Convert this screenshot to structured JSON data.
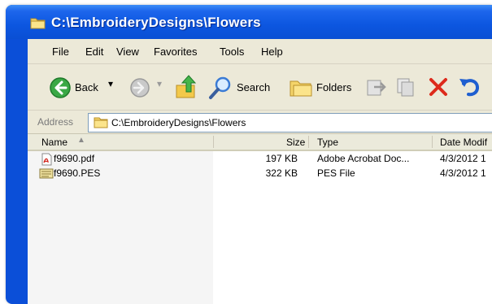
{
  "window": {
    "title": "C:\\EmbroideryDesigns\\Flowers",
    "accent": "#0b4fd8"
  },
  "menu": [
    "File",
    "Edit",
    "View",
    "Favorites",
    "Tools",
    "Help"
  ],
  "toolbar": {
    "back_label": "Back",
    "search_label": "Search",
    "folders_label": "Folders",
    "icons": [
      "back-arrow-icon",
      "forward-arrow-icon",
      "up-folder-icon",
      "search-icon",
      "folders-icon",
      "move-to-icon",
      "copy-to-icon",
      "delete-x-icon",
      "undo-icon"
    ]
  },
  "address": {
    "label": "Address",
    "path": "C:\\EmbroideryDesigns\\Flowers"
  },
  "columns": {
    "name": "Name",
    "size": "Size",
    "type": "Type",
    "date": "Date Modif"
  },
  "files": [
    {
      "name": "f9690.pdf",
      "size": "197 KB",
      "type": "Adobe Acrobat Doc...",
      "date": "4/3/2012 1",
      "icon": "pdf-file-icon"
    },
    {
      "name": "f9690.PES",
      "size": "322 KB",
      "type": "PES File",
      "date": "4/3/2012 1",
      "icon": "pes-file-icon"
    }
  ]
}
